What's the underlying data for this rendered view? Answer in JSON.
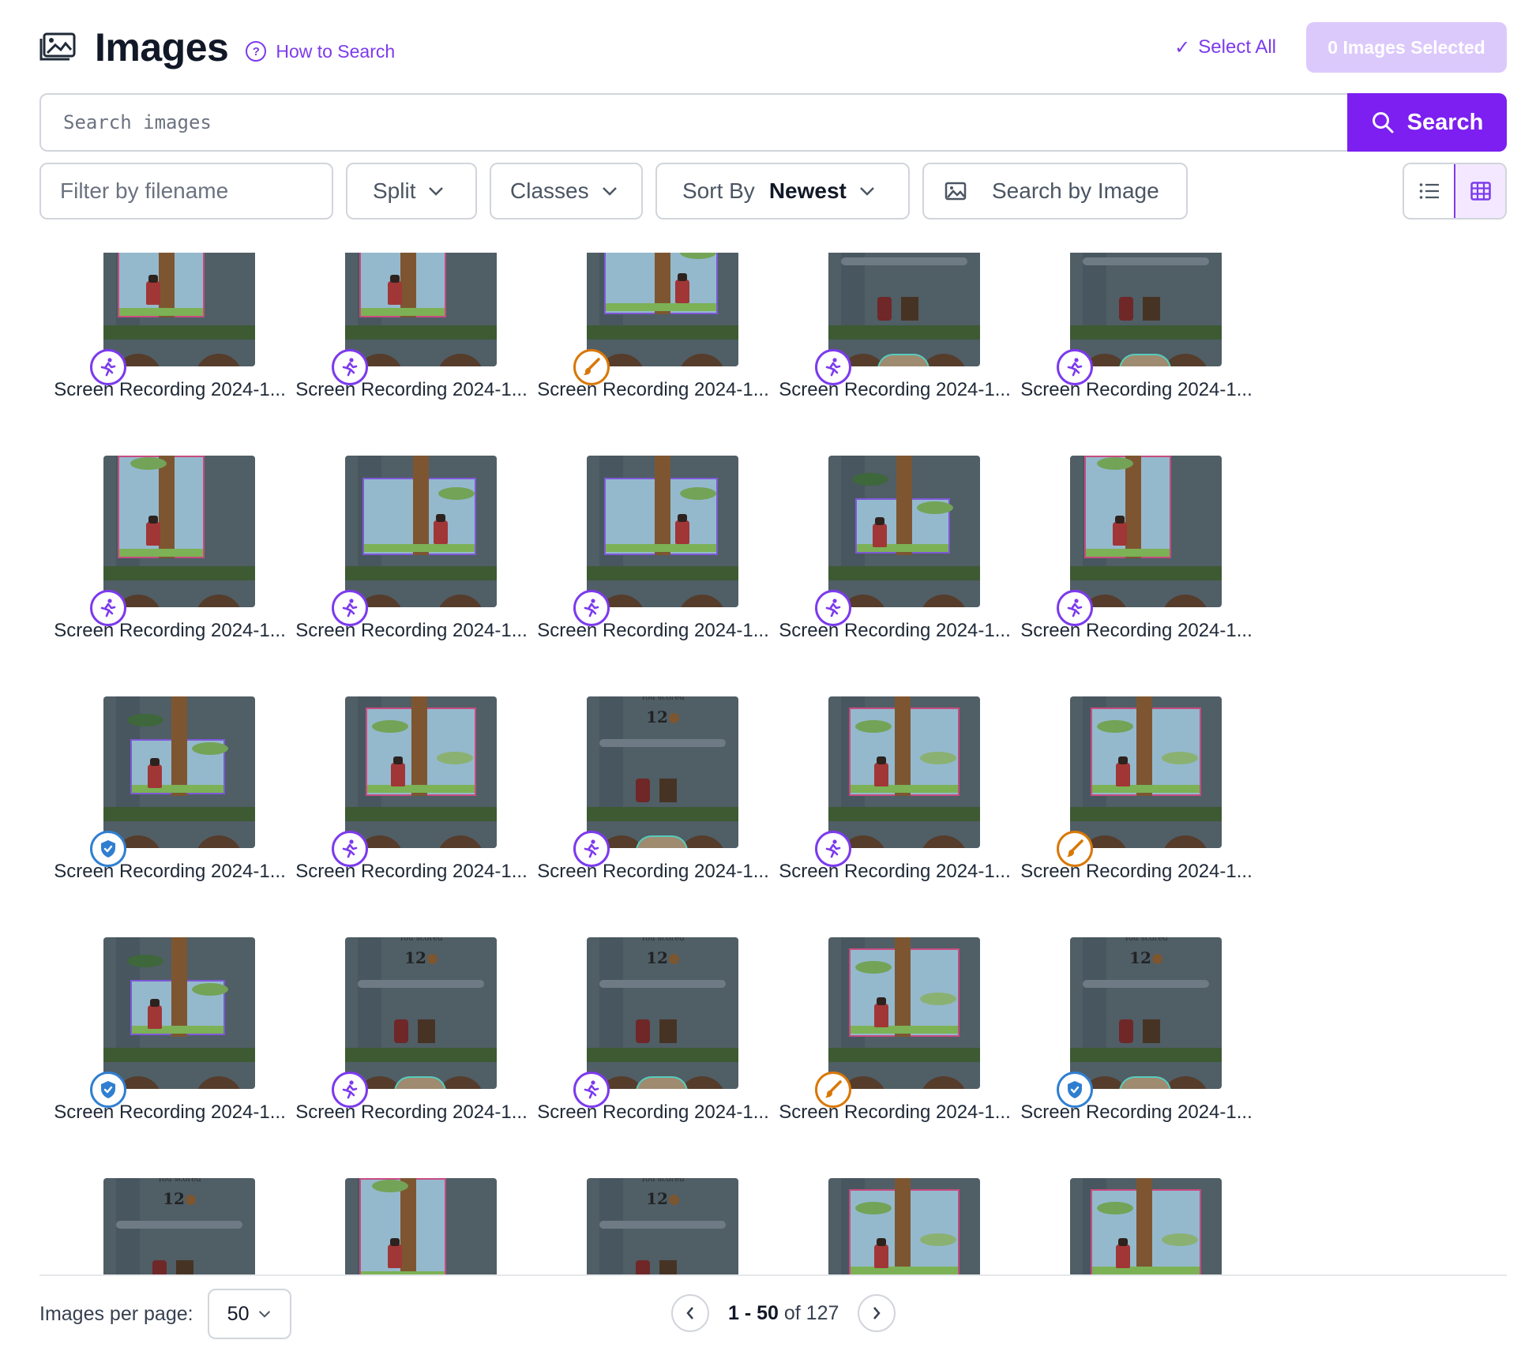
{
  "header": {
    "title": "Images",
    "how_to": "How to Search",
    "select_all": "Select All",
    "selected": "0 Images Selected"
  },
  "search": {
    "placeholder": "Search images",
    "button": "Search"
  },
  "filters": {
    "filename_placeholder": "Filter by filename",
    "split": "Split",
    "classes": "Classes",
    "sort_label": "Sort By",
    "sort_value": "Newest",
    "search_by_image": "Search by Image",
    "view_mode": "grid"
  },
  "badge_colors": {
    "purple": "#7c3aed",
    "orange": "#d97706",
    "blue": "#2f7fd1"
  },
  "cards": [
    {
      "label": "Screen Recording 2024-1...",
      "badge": "purple",
      "icon": "person-running-icon",
      "scene": "tall-pink"
    },
    {
      "label": "Screen Recording 2024-1...",
      "badge": "purple",
      "icon": "person-running-icon",
      "scene": "tall-pink"
    },
    {
      "label": "Screen Recording 2024-1...",
      "badge": "orange",
      "icon": "brush-icon",
      "scene": "wide-purple"
    },
    {
      "label": "Screen Recording 2024-1...",
      "badge": "purple",
      "icon": "person-running-icon",
      "scene": "score"
    },
    {
      "label": "Screen Recording 2024-1...",
      "badge": "purple",
      "icon": "person-running-icon",
      "scene": "score"
    },
    {
      "label": "Screen Recording 2024-1...",
      "badge": "purple",
      "icon": "person-running-icon",
      "scene": "tall-pink"
    },
    {
      "label": "Screen Recording 2024-1...",
      "badge": "purple",
      "icon": "person-running-icon",
      "scene": "wide-purple"
    },
    {
      "label": "Screen Recording 2024-1...",
      "badge": "purple",
      "icon": "person-running-icon",
      "scene": "wide-purple"
    },
    {
      "label": "Screen Recording 2024-1...",
      "badge": "purple",
      "icon": "person-running-icon",
      "scene": "small-purple"
    },
    {
      "label": "Screen Recording 2024-1...",
      "badge": "purple",
      "icon": "person-running-icon",
      "scene": "tall-pink"
    },
    {
      "label": "Screen Recording 2024-1...",
      "badge": "blue",
      "icon": "shield-check-icon",
      "scene": "small-purple"
    },
    {
      "label": "Screen Recording 2024-1...",
      "badge": "purple",
      "icon": "person-running-icon",
      "scene": "mid-pink"
    },
    {
      "label": "Screen Recording 2024-1...",
      "badge": "purple",
      "icon": "person-running-icon",
      "scene": "score"
    },
    {
      "label": "Screen Recording 2024-1...",
      "badge": "purple",
      "icon": "person-running-icon",
      "scene": "mid-pink"
    },
    {
      "label": "Screen Recording 2024-1...",
      "badge": "orange",
      "icon": "brush-icon",
      "scene": "mid-pink"
    },
    {
      "label": "Screen Recording 2024-1...",
      "badge": "blue",
      "icon": "shield-check-icon",
      "scene": "small-purple"
    },
    {
      "label": "Screen Recording 2024-1...",
      "badge": "purple",
      "icon": "person-running-icon",
      "scene": "score"
    },
    {
      "label": "Screen Recording 2024-1...",
      "badge": "purple",
      "icon": "person-running-icon",
      "scene": "score"
    },
    {
      "label": "Screen Recording 2024-1...",
      "badge": "orange",
      "icon": "brush-icon",
      "scene": "mid-pink"
    },
    {
      "label": "Screen Recording 2024-1...",
      "badge": "blue",
      "icon": "shield-check-icon",
      "scene": "score"
    },
    {
      "label": "",
      "badge": "",
      "icon": "",
      "scene": "score"
    },
    {
      "label": "",
      "badge": "",
      "icon": "",
      "scene": "tall-pink"
    },
    {
      "label": "",
      "badge": "",
      "icon": "",
      "scene": "score"
    },
    {
      "label": "",
      "badge": "",
      "icon": "",
      "scene": "mid-pink"
    },
    {
      "label": "",
      "badge": "",
      "icon": "",
      "scene": "mid-pink"
    }
  ],
  "scene_text": {
    "score_top": "You scored",
    "score_value": "12"
  },
  "footer": {
    "per_page_label": "Images per page:",
    "per_page_value": "50",
    "range": "1 - 50",
    "of_text": "of 127"
  }
}
